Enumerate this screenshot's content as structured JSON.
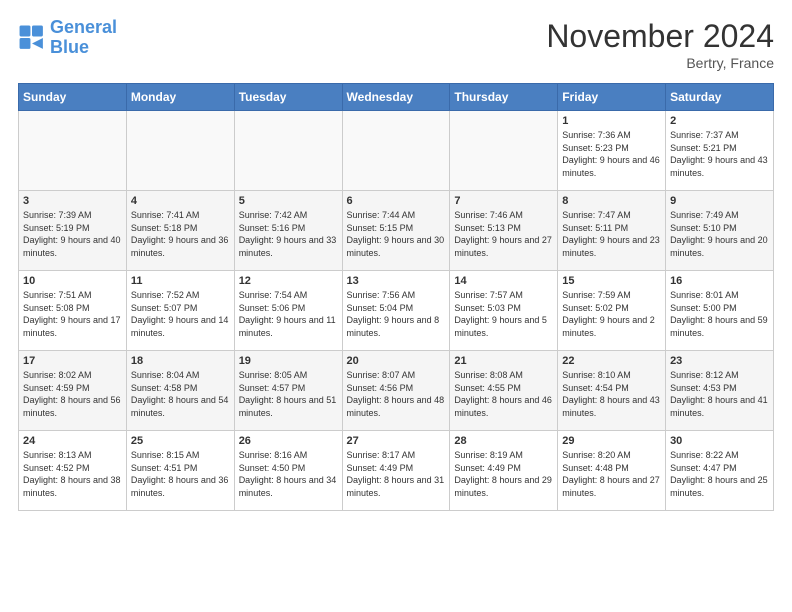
{
  "header": {
    "logo_line1": "General",
    "logo_line2": "Blue",
    "month_title": "November 2024",
    "location": "Bertry, France"
  },
  "weekdays": [
    "Sunday",
    "Monday",
    "Tuesday",
    "Wednesday",
    "Thursday",
    "Friday",
    "Saturday"
  ],
  "weeks": [
    [
      {
        "day": "",
        "info": ""
      },
      {
        "day": "",
        "info": ""
      },
      {
        "day": "",
        "info": ""
      },
      {
        "day": "",
        "info": ""
      },
      {
        "day": "",
        "info": ""
      },
      {
        "day": "1",
        "info": "Sunrise: 7:36 AM\nSunset: 5:23 PM\nDaylight: 9 hours\nand 46 minutes."
      },
      {
        "day": "2",
        "info": "Sunrise: 7:37 AM\nSunset: 5:21 PM\nDaylight: 9 hours\nand 43 minutes."
      }
    ],
    [
      {
        "day": "3",
        "info": "Sunrise: 7:39 AM\nSunset: 5:19 PM\nDaylight: 9 hours\nand 40 minutes."
      },
      {
        "day": "4",
        "info": "Sunrise: 7:41 AM\nSunset: 5:18 PM\nDaylight: 9 hours\nand 36 minutes."
      },
      {
        "day": "5",
        "info": "Sunrise: 7:42 AM\nSunset: 5:16 PM\nDaylight: 9 hours\nand 33 minutes."
      },
      {
        "day": "6",
        "info": "Sunrise: 7:44 AM\nSunset: 5:15 PM\nDaylight: 9 hours\nand 30 minutes."
      },
      {
        "day": "7",
        "info": "Sunrise: 7:46 AM\nSunset: 5:13 PM\nDaylight: 9 hours\nand 27 minutes."
      },
      {
        "day": "8",
        "info": "Sunrise: 7:47 AM\nSunset: 5:11 PM\nDaylight: 9 hours\nand 23 minutes."
      },
      {
        "day": "9",
        "info": "Sunrise: 7:49 AM\nSunset: 5:10 PM\nDaylight: 9 hours\nand 20 minutes."
      }
    ],
    [
      {
        "day": "10",
        "info": "Sunrise: 7:51 AM\nSunset: 5:08 PM\nDaylight: 9 hours\nand 17 minutes."
      },
      {
        "day": "11",
        "info": "Sunrise: 7:52 AM\nSunset: 5:07 PM\nDaylight: 9 hours\nand 14 minutes."
      },
      {
        "day": "12",
        "info": "Sunrise: 7:54 AM\nSunset: 5:06 PM\nDaylight: 9 hours\nand 11 minutes."
      },
      {
        "day": "13",
        "info": "Sunrise: 7:56 AM\nSunset: 5:04 PM\nDaylight: 9 hours\nand 8 minutes."
      },
      {
        "day": "14",
        "info": "Sunrise: 7:57 AM\nSunset: 5:03 PM\nDaylight: 9 hours\nand 5 minutes."
      },
      {
        "day": "15",
        "info": "Sunrise: 7:59 AM\nSunset: 5:02 PM\nDaylight: 9 hours\nand 2 minutes."
      },
      {
        "day": "16",
        "info": "Sunrise: 8:01 AM\nSunset: 5:00 PM\nDaylight: 8 hours\nand 59 minutes."
      }
    ],
    [
      {
        "day": "17",
        "info": "Sunrise: 8:02 AM\nSunset: 4:59 PM\nDaylight: 8 hours\nand 56 minutes."
      },
      {
        "day": "18",
        "info": "Sunrise: 8:04 AM\nSunset: 4:58 PM\nDaylight: 8 hours\nand 54 minutes."
      },
      {
        "day": "19",
        "info": "Sunrise: 8:05 AM\nSunset: 4:57 PM\nDaylight: 8 hours\nand 51 minutes."
      },
      {
        "day": "20",
        "info": "Sunrise: 8:07 AM\nSunset: 4:56 PM\nDaylight: 8 hours\nand 48 minutes."
      },
      {
        "day": "21",
        "info": "Sunrise: 8:08 AM\nSunset: 4:55 PM\nDaylight: 8 hours\nand 46 minutes."
      },
      {
        "day": "22",
        "info": "Sunrise: 8:10 AM\nSunset: 4:54 PM\nDaylight: 8 hours\nand 43 minutes."
      },
      {
        "day": "23",
        "info": "Sunrise: 8:12 AM\nSunset: 4:53 PM\nDaylight: 8 hours\nand 41 minutes."
      }
    ],
    [
      {
        "day": "24",
        "info": "Sunrise: 8:13 AM\nSunset: 4:52 PM\nDaylight: 8 hours\nand 38 minutes."
      },
      {
        "day": "25",
        "info": "Sunrise: 8:15 AM\nSunset: 4:51 PM\nDaylight: 8 hours\nand 36 minutes."
      },
      {
        "day": "26",
        "info": "Sunrise: 8:16 AM\nSunset: 4:50 PM\nDaylight: 8 hours\nand 34 minutes."
      },
      {
        "day": "27",
        "info": "Sunrise: 8:17 AM\nSunset: 4:49 PM\nDaylight: 8 hours\nand 31 minutes."
      },
      {
        "day": "28",
        "info": "Sunrise: 8:19 AM\nSunset: 4:49 PM\nDaylight: 8 hours\nand 29 minutes."
      },
      {
        "day": "29",
        "info": "Sunrise: 8:20 AM\nSunset: 4:48 PM\nDaylight: 8 hours\nand 27 minutes."
      },
      {
        "day": "30",
        "info": "Sunrise: 8:22 AM\nSunset: 4:47 PM\nDaylight: 8 hours\nand 25 minutes."
      }
    ]
  ]
}
